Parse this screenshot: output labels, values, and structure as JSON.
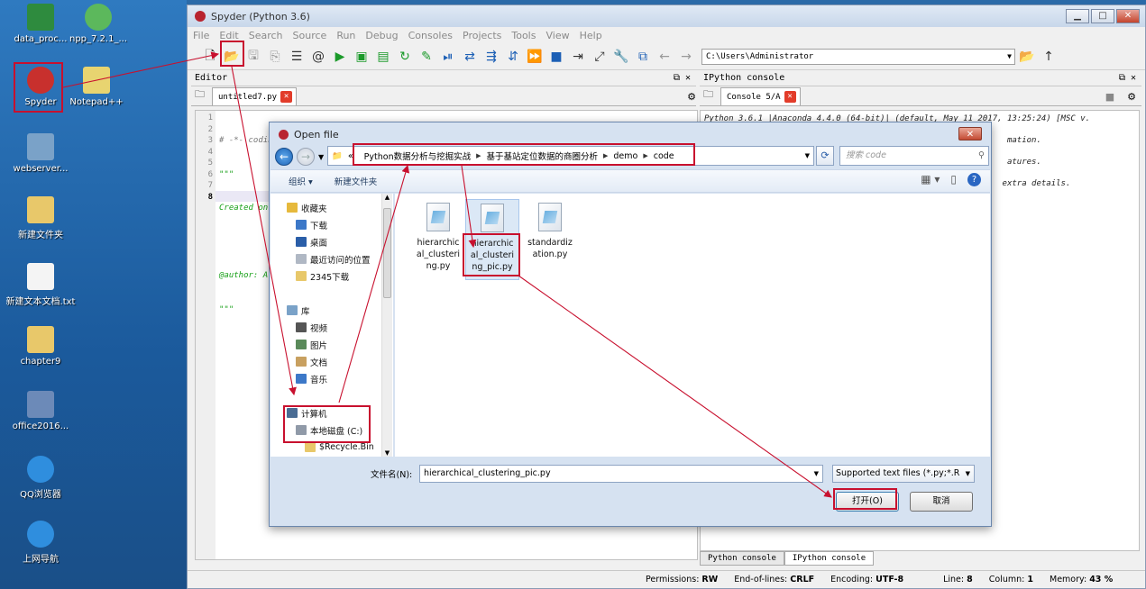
{
  "desktop": {
    "icons": [
      {
        "label": "data_proc...",
        "color": "#2e8b3e"
      },
      {
        "label": "npp_7.2.1_...",
        "color": "#5cb85c"
      },
      {
        "label": "Spyder",
        "color": "#c8302d"
      },
      {
        "label": "Notepad++",
        "color": "#e8d470"
      },
      {
        "label": "webserver...",
        "color": "#7aa2c8"
      },
      {
        "label": "新建文件夹",
        "color": "#e8c86a"
      },
      {
        "label": "新建文本文档.txt",
        "color": "#f4f4f4"
      },
      {
        "label": "chapter9",
        "color": "#e8c86a"
      },
      {
        "label": "office2016...",
        "color": "#6c8ab8"
      },
      {
        "label": "QQ浏览器",
        "color": "#2f8ede"
      },
      {
        "label": "上网导航",
        "color": "#2f8ede"
      }
    ]
  },
  "window": {
    "title": "Spyder (Python 3.6)",
    "buttons": [
      "▁",
      "□",
      "✕"
    ]
  },
  "menu": [
    "File",
    "Edit",
    "Search",
    "Source",
    "Run",
    "Debug",
    "Consoles",
    "Projects",
    "Tools",
    "View",
    "Help"
  ],
  "toolbar": {
    "working_dir": "C:\\Users\\Administrator",
    "icons": [
      "new-file-icon",
      "open-folder-icon",
      "save-icon",
      "save-all-icon",
      "list-icon",
      "at-icon",
      "run-icon",
      "run-cell-icon",
      "run-cell-advance-icon",
      "rerun-icon",
      "wrench-run-icon",
      "debug-icon",
      "step-icon",
      "step-into-icon",
      "step-return-icon",
      "continue-icon",
      "stop-icon",
      "maximize-pane-icon",
      "fullscreen-icon",
      "preferences-icon",
      "python-path-icon",
      "back-icon",
      "forward-icon"
    ]
  },
  "editor": {
    "pane_title": "Editor",
    "tab_label": "untitled7.py",
    "line_numbers": [
      "1",
      "2",
      "3",
      "4",
      "5",
      "6",
      "7",
      "8"
    ],
    "lines": [
      "# -*- coding: utf-8 -*-",
      "\"\"\"",
      "Created on",
      "",
      "@author: A",
      "\"\"\"",
      "",
      ""
    ]
  },
  "ipython": {
    "pane_title": "IPython console",
    "tab_label": "Console 5/A",
    "lines": [
      "Python 3.6.1 |Anaconda 4.4.0 (64-bit)| (default, May 11 2017, 13:25:24) [MSC v.",
      "",
      "                                                              mation.",
      "",
      "                                                              atures.",
      "",
      "                                                             extra details."
    ],
    "bottom_tabs": [
      "Python console",
      "IPython console"
    ]
  },
  "status": {
    "permissions_label": "Permissions:",
    "permissions": "RW",
    "eol_label": "End-of-lines:",
    "eol": "CRLF",
    "encoding_label": "Encoding:",
    "encoding": "UTF-8",
    "line_label": "Line:",
    "line": "8",
    "column_label": "Column:",
    "column": "1",
    "memory_label": "Memory:",
    "memory": "43 %"
  },
  "dialog": {
    "title": "Open file",
    "breadcrumb": [
      "«",
      "Python数据分析与挖掘实战",
      "基于基站定位数据的商圈分析",
      "demo",
      "code"
    ],
    "search_placeholder": "搜索 code",
    "organize": "组织 ▾",
    "new_folder": "新建文件夹",
    "nav_items": [
      {
        "label": "收藏夹",
        "level": 0,
        "color": "#e6b93c"
      },
      {
        "label": "下载",
        "level": 1,
        "color": "#3c78c8"
      },
      {
        "label": "桌面",
        "level": 1,
        "color": "#2a5ea8"
      },
      {
        "label": "最近访问的位置",
        "level": 1,
        "color": "#b0b8c4"
      },
      {
        "label": "2345下载",
        "level": 1,
        "color": "#e8c86a"
      },
      {
        "label": "",
        "level": 0,
        "color": ""
      },
      {
        "label": "库",
        "level": 0,
        "color": "#7aa2c8"
      },
      {
        "label": "视频",
        "level": 1,
        "color": "#555"
      },
      {
        "label": "图片",
        "level": 1,
        "color": "#5a8a5a"
      },
      {
        "label": "文档",
        "level": 1,
        "color": "#c8a060"
      },
      {
        "label": "音乐",
        "level": 1,
        "color": "#3c78c8"
      },
      {
        "label": "",
        "level": 0,
        "color": ""
      },
      {
        "label": "计算机",
        "level": 0,
        "color": "#4a6c94"
      },
      {
        "label": "本地磁盘 (C:)",
        "level": 1,
        "color": "#909aa8"
      },
      {
        "label": "$Recycle.Bin",
        "level": 2,
        "color": "#e8c86a"
      }
    ],
    "files": [
      {
        "name": "hierarchical_clustering.py",
        "lines": [
          "hierarchic",
          "al_clusteri",
          "ng.py"
        ]
      },
      {
        "name": "hierarchical_clustering_pic.py",
        "lines": [
          "hierarchic",
          "al_clusteri",
          "ng_pic.py"
        ]
      },
      {
        "name": "standardization.py",
        "lines": [
          "standardiz",
          "ation.py"
        ]
      }
    ],
    "filename_label": "文件名(N):",
    "filename_value": "hierarchical_clustering_pic.py",
    "filter": "Supported text files (*.py;*.R",
    "open_button": "打开(O)",
    "cancel_button": "取消"
  },
  "annotation_color": "#c8102e"
}
